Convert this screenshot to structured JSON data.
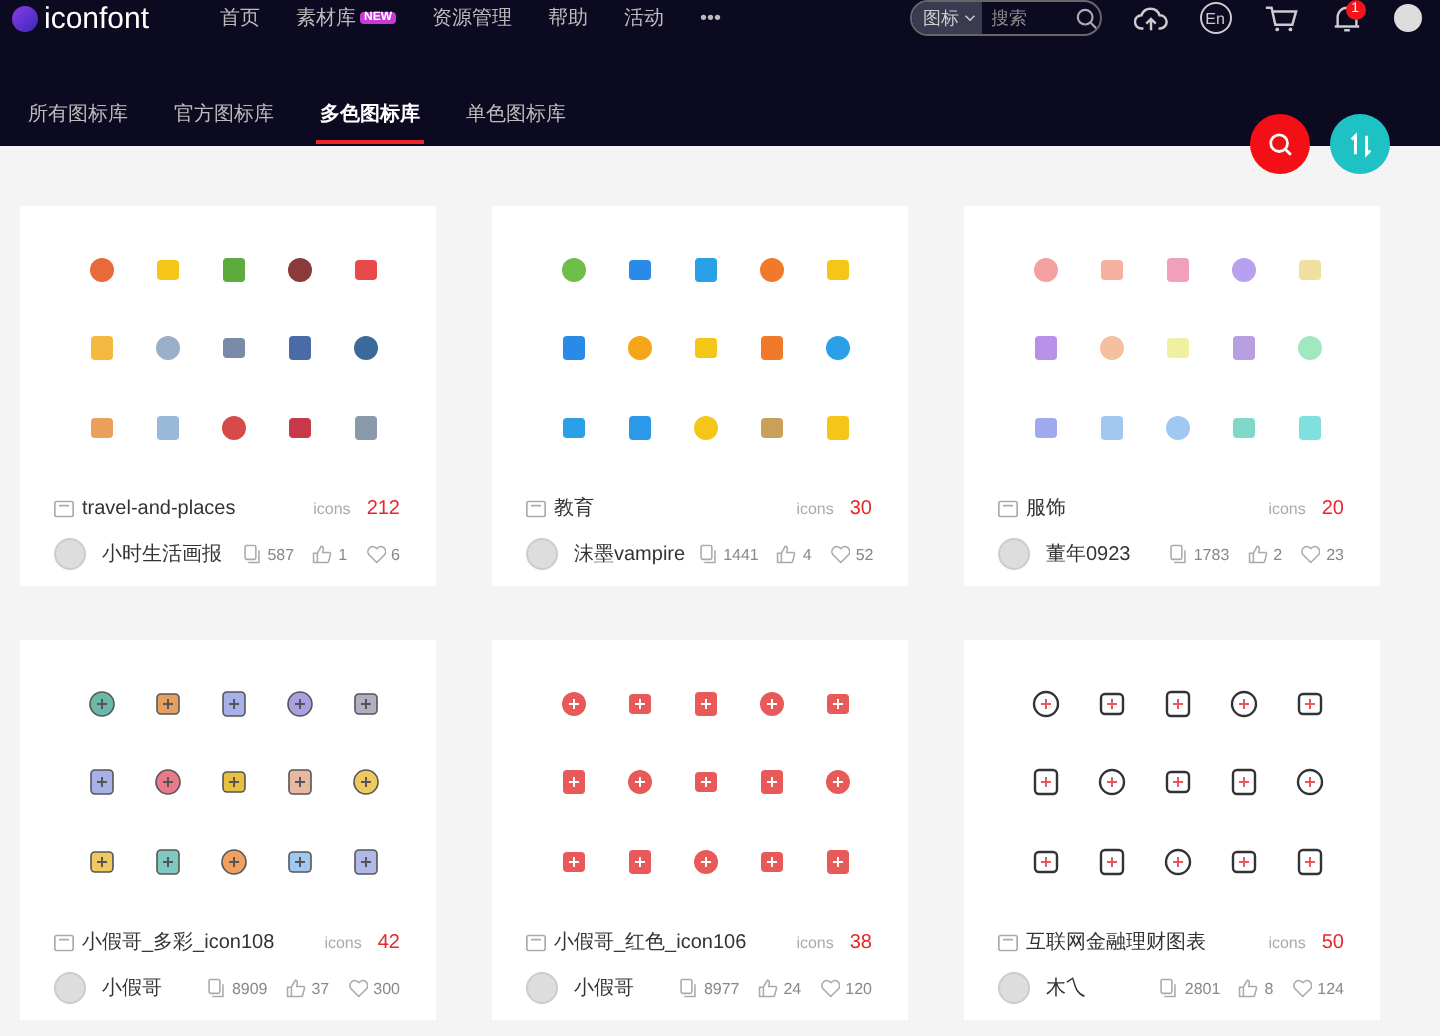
{
  "nav": {
    "logo": "iconfont",
    "items": [
      {
        "label": "首页"
      },
      {
        "label": "素材库",
        "badge": "NEW"
      },
      {
        "label": "资源管理"
      },
      {
        "label": "帮助"
      },
      {
        "label": "活动"
      },
      {
        "label": "•••"
      }
    ]
  },
  "search": {
    "scope": "图标",
    "placeholder": "搜索"
  },
  "language": "En",
  "notifications": "1",
  "tabs": [
    {
      "label": "所有图标库",
      "selected": false
    },
    {
      "label": "官方图标库",
      "selected": false
    },
    {
      "label": "多色图标库",
      "selected": true
    },
    {
      "label": "单色图标库",
      "selected": false
    }
  ],
  "cards": [
    {
      "kind": "multicolor",
      "title": "travel-and-places",
      "icons_label": "icons",
      "count": "212",
      "author": "小时生活画报",
      "stats": [
        "587",
        "1",
        "6"
      ]
    },
    {
      "kind": "flat",
      "title": "教育",
      "icons_label": "icons",
      "count": "30",
      "author": "沫墨vampire",
      "stats": [
        "1441",
        "4",
        "52"
      ]
    },
    {
      "kind": "pastel",
      "title": "服饰",
      "icons_label": "icons",
      "count": "20",
      "author": "董年0923",
      "stats": [
        "1783",
        "2",
        "23"
      ]
    },
    {
      "kind": "soft",
      "title": "小假哥_多彩_icon108",
      "icons_label": "icons",
      "count": "42",
      "author": "小假哥",
      "stats": [
        "8909",
        "37",
        "300"
      ]
    },
    {
      "kind": "red",
      "title": "小假哥_红色_icon106",
      "icons_label": "icons",
      "count": "38",
      "author": "小假哥",
      "stats": [
        "8977",
        "24",
        "120"
      ]
    },
    {
      "kind": "outline",
      "title": "互联网金融理财图表",
      "icons_label": "icons",
      "count": "50",
      "author": "木乀",
      "stats": [
        "2801",
        "8",
        "124"
      ]
    }
  ]
}
